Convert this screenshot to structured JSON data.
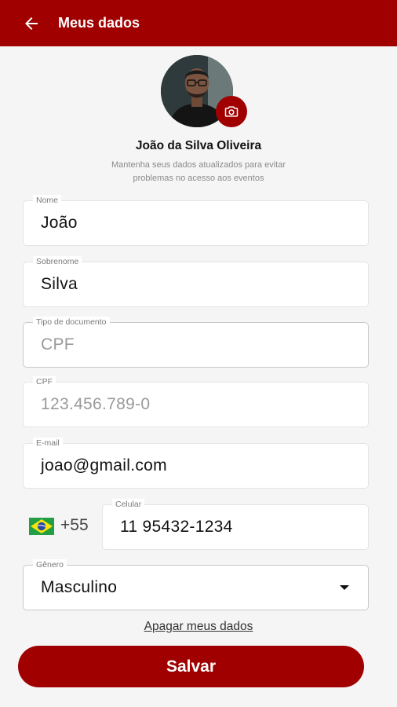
{
  "header": {
    "title": "Meus dados",
    "back_icon": "arrow-left-icon"
  },
  "profile": {
    "name": "João da Silva Oliveira",
    "hint": "Mantenha seus dados atualizados para evitar problemas no acesso aos eventos",
    "camera_icon": "camera-icon"
  },
  "form": {
    "nome": {
      "label": "Nome",
      "value": "João"
    },
    "sobrenome": {
      "label": "Sobrenome",
      "value": "Silva"
    },
    "tipo_documento": {
      "label": "Tipo de documento",
      "value": "CPF"
    },
    "cpf": {
      "label": "CPF",
      "value": "123.456.789-0"
    },
    "email": {
      "label": "E-mail",
      "value": "joao@gmail.com"
    },
    "ddi": "+55",
    "celular": {
      "label": "Celular",
      "value": "11 95432-1234"
    },
    "genero": {
      "label": "Gênero",
      "value": "Masculino"
    }
  },
  "actions": {
    "delete_label": "Apagar meus dados",
    "save_label": "Salvar"
  },
  "colors": {
    "brand": "#a00000",
    "background": "#f5f5f5"
  }
}
